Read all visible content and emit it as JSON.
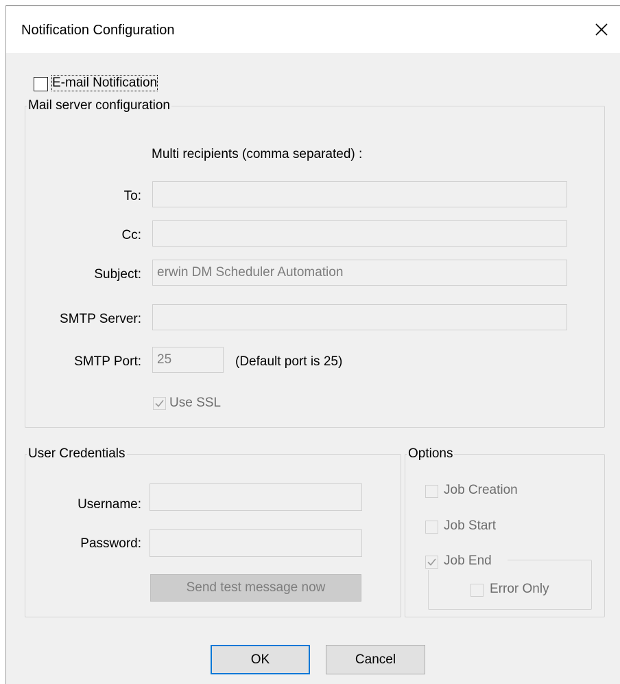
{
  "window": {
    "title": "Notification Configuration",
    "close_icon": "close-icon"
  },
  "email_notification": {
    "label": "E-mail Notification",
    "checked": false
  },
  "mail_server": {
    "group_label": "Mail server configuration",
    "multi_recipients_label": "Multi recipients (comma separated) :",
    "to_label": "To:",
    "to_value": "",
    "cc_label": "Cc:",
    "cc_value": "",
    "subject_label": "Subject:",
    "subject_value": "erwin DM Scheduler Automation",
    "smtp_server_label": "SMTP Server:",
    "smtp_server_value": "",
    "smtp_port_label": "SMTP Port:",
    "smtp_port_value": "25",
    "default_port_note": "(Default port is 25)",
    "use_ssl_label": "Use SSL",
    "use_ssl_checked": true
  },
  "credentials": {
    "group_label": "User Credentials",
    "username_label": "Username:",
    "username_value": "",
    "password_label": "Password:",
    "password_value": "",
    "send_test_label": "Send test message now"
  },
  "options": {
    "group_label": "Options",
    "job_creation_label": "Job Creation",
    "job_creation_checked": false,
    "job_start_label": "Job Start",
    "job_start_checked": false,
    "job_end_label": "Job End",
    "job_end_checked": true,
    "error_only_label": "Error Only",
    "error_only_checked": false
  },
  "footer": {
    "ok_label": "OK",
    "cancel_label": "Cancel"
  },
  "colors": {
    "default_button_border": "#0078d7",
    "disabled_text": "#6d6d6d",
    "dialog_bg": "#f0f0f0"
  }
}
